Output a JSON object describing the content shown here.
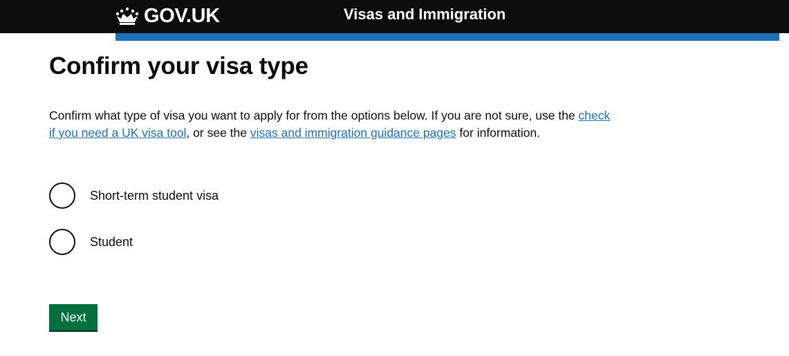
{
  "header": {
    "logo_text": "GOV.UK",
    "service_name": "Visas and Immigration"
  },
  "main": {
    "title": "Confirm your visa type",
    "intro": {
      "part1": "Confirm what type of visa you want to apply for from the options below. If you are not sure, use the ",
      "link1": "check if you need a UK visa tool",
      "part2": ", or see the ",
      "link2": "visas and immigration guidance pages",
      "part3": " for information."
    },
    "options": [
      {
        "label": "Short-term student visa",
        "selected": false
      },
      {
        "label": "Student",
        "selected": false
      }
    ],
    "next_label": "Next"
  },
  "colors": {
    "header_bg": "#0b0c0c",
    "accent_bar": "#1d70b8",
    "link": "#1d70b8",
    "button_bg": "#00703c"
  },
  "icons": {
    "logo": "crown-icon"
  }
}
